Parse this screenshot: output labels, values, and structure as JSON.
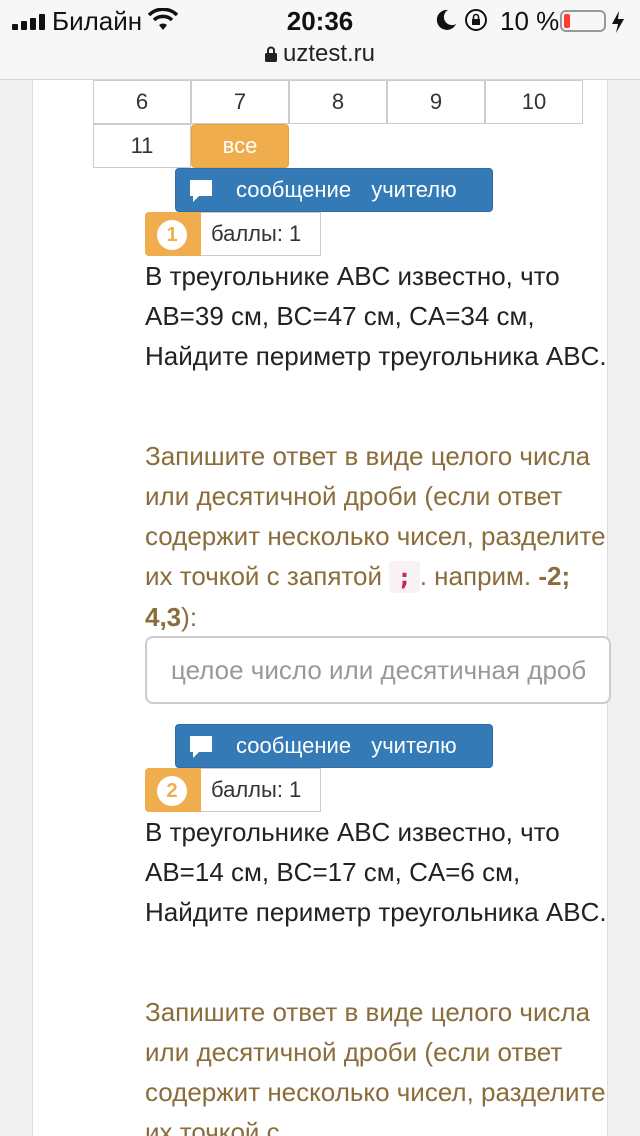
{
  "status": {
    "carrier": "Билайн",
    "time": "20:36",
    "battery": "10 %"
  },
  "browser": {
    "url": "uztest.ru"
  },
  "pager": {
    "pages": [
      "6",
      "7",
      "8",
      "9",
      "10",
      "11"
    ],
    "all_label": "все"
  },
  "message_button": {
    "label": "сообщение учителю"
  },
  "questions": [
    {
      "number": "1",
      "score": "баллы: 1",
      "text": "В треугольнике ABC известно, что AB=39 см, BC=47 см, CA=34 см, Найдите периметр треугольника ABC.",
      "hint_before": "Запишите ответ в виде целого числа или десятичной дроби (если ответ содержит несколько чисел, разделите их точкой с запятой ",
      "hint_code": ";",
      "hint_middle": ". наприм. ",
      "hint_example": "-2; 4,3",
      "hint_after": "):",
      "placeholder": "целое число или десятичная дробь"
    },
    {
      "number": "2",
      "score": "баллы: 1",
      "text": "В треугольнике ABC известно, что AB=14 см, BC=17 см, CA=6 см, Найдите периметр треугольника ABC.",
      "hint_before": "Запишите ответ в виде целого числа или десятичной дроби (если ответ содержит несколько чисел, разделите их точкой с"
    }
  ],
  "colors": {
    "accent_orange": "#f0ad4e",
    "button_blue": "#337ab7",
    "hint_text": "#8a6d3b",
    "code_text": "#c7254e"
  }
}
